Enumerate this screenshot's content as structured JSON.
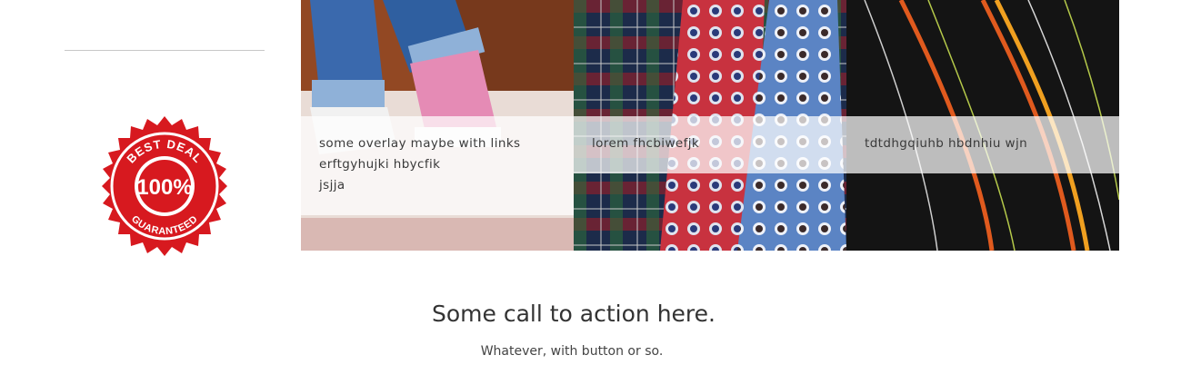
{
  "badge": {
    "top_text": "BEST DEAL",
    "center_text": "100%",
    "bottom_text": "GUARANTEED",
    "color": "#d7191f"
  },
  "tiles": [
    {
      "image": "sneakers-jeans-photo",
      "overlay_text": "some overlay maybe with links\nerftgyhujki hbycfik\njsjja"
    },
    {
      "image": "plaid-polka-dot-ties-photo",
      "overlay_text": "lorem fhcbiwefjk"
    },
    {
      "image": "striped-ties-photo",
      "overlay_text": "tdtdhgqiuhb hbdnhiu wjn"
    }
  ],
  "cta": {
    "title": "Some call to action here.",
    "subtitle": "Whatever, with button or so."
  }
}
